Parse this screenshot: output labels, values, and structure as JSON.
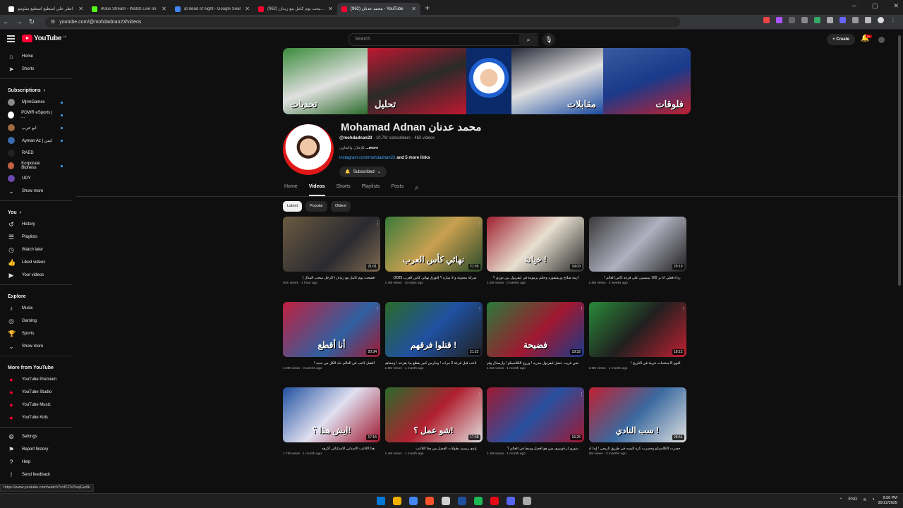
{
  "browser": {
    "tabs": [
      {
        "title": "انظر علي اسطيع اسطيع سلومو",
        "fav": "#ffffff"
      },
      {
        "title": "iKilus Stream - Watch Live on",
        "fav": "#53fc18"
      },
      {
        "title": "at dead of night - Google Sear",
        "fav": "#4285f4"
      },
      {
        "title": "(962) فضيحت يوم كامل مع زيدان",
        "fav": "#ff0033"
      },
      {
        "title": "(962) محمد عدنان - YouTube",
        "fav": "#ff0033"
      }
    ],
    "active_tab": 4,
    "url": "youtube.com/@mohdadnan23/videos",
    "status_url": "https://www.youtube.com/watch?v=fFOVSuqGw9k"
  },
  "header": {
    "logo_text": "YouTube",
    "country_code": "AE",
    "search_placeholder": "Search",
    "create_label": "Create",
    "notif_count": "9+"
  },
  "sidebar": {
    "main": [
      {
        "label": "Home",
        "icon": "⌂"
      },
      {
        "label": "Shorts",
        "icon": "➤"
      }
    ],
    "subscriptions_title": "Subscriptions",
    "subscriptions": [
      {
        "label": "MjrmGames",
        "color": "#8a8a8a",
        "dot": true
      },
      {
        "label": "POWR eSports | ...",
        "color": "#ffffff",
        "dot": true
      },
      {
        "label": "ابو عرب",
        "color": "#a06a40",
        "dot": true
      },
      {
        "label": "Ayman Az | ايمن",
        "color": "#3a6db0",
        "dot": true
      },
      {
        "label": "RAED",
        "color": "#222222",
        "dot": false
      },
      {
        "label": "Korporate Bidness",
        "color": "#c06040",
        "dot": true
      },
      {
        "label": "UDY",
        "color": "#6a4ab0",
        "dot": false
      }
    ],
    "show_more": "Show more",
    "you_title": "You",
    "you": [
      {
        "label": "History",
        "icon": "↺"
      },
      {
        "label": "Playlists",
        "icon": "☰"
      },
      {
        "label": "Watch later",
        "icon": "◷"
      },
      {
        "label": "Liked videos",
        "icon": "👍"
      },
      {
        "label": "Your videos",
        "icon": "▶"
      }
    ],
    "explore_title": "Explore",
    "explore": [
      {
        "label": "Music",
        "icon": "♪"
      },
      {
        "label": "Gaming",
        "icon": "◎"
      },
      {
        "label": "Sports",
        "icon": "🏆"
      }
    ],
    "show_more_2": "Show more",
    "more_title": "More from YouTube",
    "more": [
      {
        "label": "YouTube Premium"
      },
      {
        "label": "YouTube Studio"
      },
      {
        "label": "YouTube Music"
      },
      {
        "label": "YouTube Kids"
      }
    ],
    "footer": [
      {
        "label": "Settings",
        "icon": "⚙"
      },
      {
        "label": "Report history",
        "icon": "⚑"
      },
      {
        "label": "Help",
        "icon": "?"
      },
      {
        "label": "Send feedback",
        "icon": "!"
      }
    ]
  },
  "banner_labels": [
    "تحديات",
    "تحليل",
    "مقابلات",
    "فلوقات"
  ],
  "channel": {
    "name": "Mohamad Adnan محمد عدنان",
    "handle": "@mohdadnan23",
    "subscribers": "10.7M subscribers",
    "videos": "463 videos",
    "description": "للإعلان والتعاون",
    "more": "...more",
    "link": "instagram.com/mohdadnan23",
    "more_links": "and 5 more links",
    "subscribed_label": "Subscribed"
  },
  "tabs": [
    "Home",
    "Videos",
    "Shorts",
    "Playlists",
    "Posts"
  ],
  "active_tab": "Videos",
  "chips": [
    "Latest",
    "Popular",
    "Oldest"
  ],
  "active_chip": "Latest",
  "videos": [
    {
      "title": "فضحت يوم كامل مع زيدان ( الرجل سحب المتال )",
      "views": "91K views",
      "age": "1 hour ago",
      "duration": "21:01",
      "text": "",
      "bg": "linear-gradient(135deg,#6a5a40,#2a2a30 60%,#806a50)"
    },
    {
      "title": "سركة مجنونة و لا مبارة ؟ (فوزق نهائي كأس العرب 2025)",
      "views": "1.4M views",
      "age": "10 days ago",
      "duration": "21:35",
      "text": "نهائي كأس العرب",
      "bg": "linear-gradient(135deg,#3a7a3a,#c9a050 50%,#2a4a2a)"
    },
    {
      "title": "أزمة صلاح وريشفورد وحكم برمودة في ليفربول بين دوري ؟",
      "views": "1.5M views",
      "age": "2 weeks ago",
      "duration": "19:03",
      "text": "خيانة !",
      "bg": "linear-gradient(135deg,#a02030,#e8e0d0 50%,#2a2a2a)"
    },
    {
      "title": "رداء فعلي انا بر 100 بيتيسين على فرعة كأس العالم !",
      "views": "1.6M views",
      "age": "3 weeks ago",
      "duration": "20:19",
      "text": "",
      "bg": "linear-gradient(135deg,#3a3a3a,#b0b0c0 50%,#202020)"
    },
    {
      "title": "أفضل لاعب في العالم حاد الكل من جديد !",
      "views": "1.8M views",
      "age": "3 weeks ago",
      "duration": "20:34",
      "text": "أنا أقطع",
      "bg": "linear-gradient(135deg,#c02040,#3060a0 60%,#a01830)"
    },
    {
      "title": "لاعب قبل قرعة 3 مرات ! وحارس كبير يقطع يدا يقرعه ! وجماهير في الدوري",
      "views": "1.9M views",
      "age": "1 month ago",
      "duration": "21:22",
      "text": "قتلوا فرقهم !",
      "bg": "linear-gradient(135deg,#2a6a2a,#2050a0 50%,#202020)"
    },
    {
      "title": "شي غريب حصل ليفربول مدريد ! وروح الكلاسيكو ! وارسنال وفرحة بايرن",
      "views": "1.6M views",
      "age": "1 month ago",
      "duration": "19:32",
      "text": "فضيحة",
      "bg": "linear-gradient(135deg,#2a7a3a,#a01830 55%,#1a3a8a)"
    },
    {
      "title": "أقوى 8 منتخبات عربية في التاريخ !",
      "views": "2.6M views",
      "age": "1 month ago",
      "duration": "18:12",
      "text": "",
      "bg": "linear-gradient(135deg,#2a8a3a,#202020 50%,#c02030)"
    },
    {
      "title": "هذا اللاعب الأسباني الاستثنائي أكرهه",
      "views": "1.7M views",
      "age": "1 month ago",
      "duration": "17:15",
      "text": "ايش هذا ؟!",
      "bg": "linear-gradient(135deg,#2050a0,#e0e0f0 50%,#a01830)"
    },
    {
      "title": "إيدي ريسيد بطولات الفضل من هذا اللاعب",
      "views": "1.4M views",
      "age": "1 month ago",
      "duration": "17:38",
      "text": "شو عمل ؟!",
      "bg": "linear-gradient(135deg,#2a6a2a,#b02030 50%,#e0e0e0)"
    },
    {
      "title": "يدوري آر قوبيري مين هو أفضل وسط في العالم ؟",
      "views": "1.3M views",
      "age": "1 month ago",
      "duration": "16:25",
      "text": "",
      "bg": "linear-gradient(135deg,#a01830,#2a50a0 50%,#a01830)"
    },
    {
      "title": "حصرت الكلاسيكو وخسرت كرة اليسه في طريق تاريخي ! إيدا لم شفاهي",
      "views": "2M views",
      "age": "2 months ago",
      "duration": "28:54",
      "text": "سب النادي !",
      "bg": "linear-gradient(135deg,#c02030,#3a6aa0 50%,#e0e0e0)"
    }
  ],
  "taskbar": {
    "icons": [
      "#0078d4",
      "#f0b000",
      "#4285f4",
      "#fb542b",
      "#d0d0d0",
      "#1f4f9f",
      "#1db954",
      "#e50914",
      "#5865f2",
      "#aaaaaa"
    ],
    "lang": "ENG",
    "time": "9:56 PM",
    "date": "30/12/2025"
  }
}
